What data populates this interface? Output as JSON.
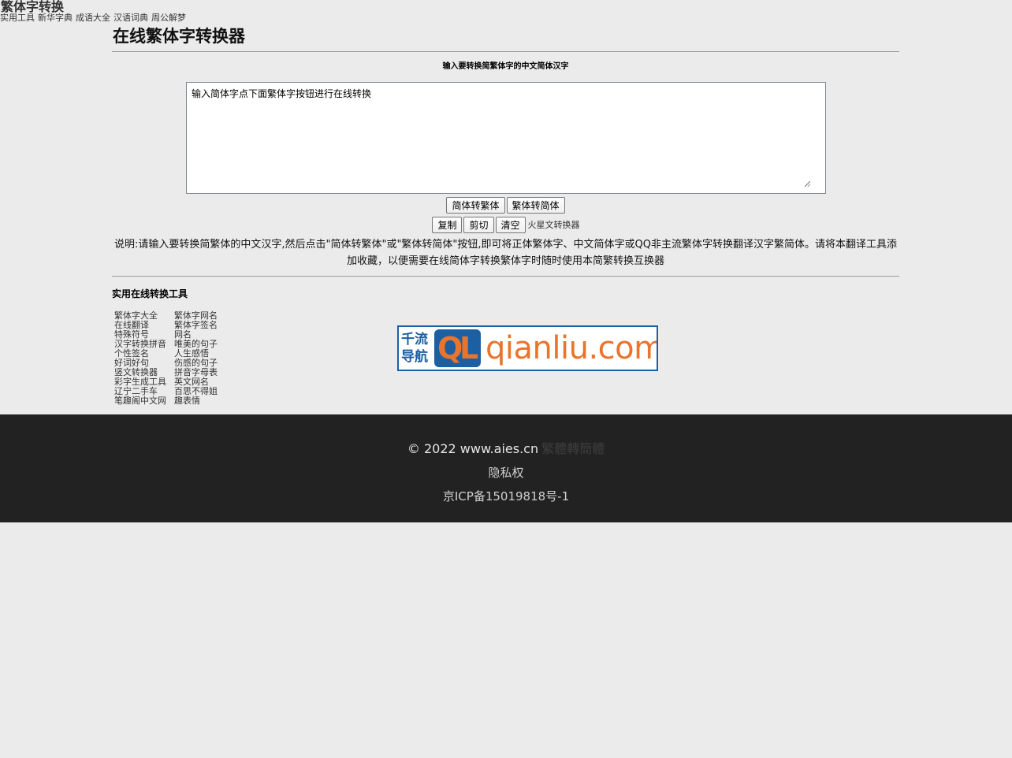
{
  "header": {
    "site_title": "繁体字转换",
    "nav": [
      "实用工具",
      "新华字典",
      "成语大全",
      "汉语词典",
      "周公解梦"
    ]
  },
  "main": {
    "title": "在线繁体字转换器",
    "instruction": "输入要转换简繁体字的中文简体汉字",
    "textarea_value": "输入简体字点下面繁体字按钮进行在线转换",
    "buttons_row1": [
      "简体转繁体",
      "繁体转简体"
    ],
    "buttons_row2": [
      "复制",
      "剪切",
      "清空"
    ],
    "extra_link": "火星文转换器",
    "description": "说明:请输入要转换简繁体的中文汉字,然后点击\"简体转繁体\"或\"繁体转简体\"按钮,即可将正体繁体字、中文简体字或QQ非主流繁体字转换翻译汉字繁简体。请将本翻译工具添加收藏，以便需要在线简体字转换繁体字时随时使用本简繁转换互换器"
  },
  "tools": {
    "heading": "实用在线转换工具",
    "links": [
      "繁体字大全",
      "繁体字网名",
      "在线翻译",
      "繁体字签名",
      "特殊符号",
      "网名",
      "汉字转换拼音",
      "唯美的句子",
      "个性签名",
      "人生感悟",
      "好词好句",
      "伤感的句子",
      "竖文转换器",
      "拼音字母表",
      "彩字生成工具",
      "英文网名",
      "辽宁二手车",
      "百思不得姐",
      "笔趣阁中文网",
      "趣表情"
    ]
  },
  "banner": {
    "cn_line1": "千流",
    "cn_line2": "导航",
    "q": "Q",
    "l": "L",
    "domain": "qianliu.com",
    "colors": {
      "blue": "#1d5fa3",
      "orange": "#e9742b"
    }
  },
  "footer": {
    "copyright": "© 2022 www.aies.cn",
    "faint_text": "繁體轉簡體",
    "privacy": "隐私权",
    "icp": "京ICP备15019818号-1",
    "colors": {
      "background": "#222222"
    }
  }
}
